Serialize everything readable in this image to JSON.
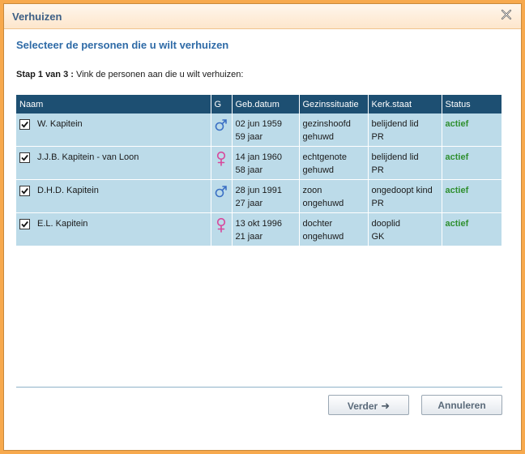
{
  "dialog": {
    "title": "Verhuizen",
    "heading": "Selecteer de personen die u wilt verhuizen",
    "step_bold": "Stap 1 van 3 :",
    "step_text": " Vink de personen aan die u wilt verhuizen:"
  },
  "table": {
    "headers": [
      "Naam",
      "G",
      "Geb.datum",
      "Gezinssituatie",
      "Kerk.staat",
      "Status"
    ],
    "rows": [
      {
        "checked": true,
        "naam": "W. Kapitein",
        "gender": "male-icon",
        "datum": "02 jun 1959",
        "leeftijd": "59 jaar",
        "gezin1": "gezinshoofd",
        "gezin2": "gehuwd",
        "kerk1": "belijdend lid",
        "kerk2": "PR",
        "status": "actief"
      },
      {
        "checked": true,
        "naam": "J.J.B. Kapitein - van Loon",
        "gender": "female-icon",
        "datum": "14 jan 1960",
        "leeftijd": "58 jaar",
        "gezin1": "echtgenote",
        "gezin2": "gehuwd",
        "kerk1": "belijdend lid",
        "kerk2": "PR",
        "status": "actief"
      },
      {
        "checked": true,
        "naam": "D.H.D. Kapitein",
        "gender": "male-icon",
        "datum": "28 jun 1991",
        "leeftijd": "27 jaar",
        "gezin1": "zoon",
        "gezin2": "ongehuwd",
        "kerk1": "ongedoopt kind",
        "kerk2": "PR",
        "status": "actief"
      },
      {
        "checked": true,
        "naam": "E.L. Kapitein",
        "gender": "female-icon",
        "datum": "13 okt 1996",
        "leeftijd": "21 jaar",
        "gezin1": "dochter",
        "gezin2": "ongehuwd",
        "kerk1": "dooplid",
        "kerk2": "GK",
        "status": "actief"
      }
    ]
  },
  "buttons": {
    "next_label": "Verder",
    "next_icon": "arrow-right-icon",
    "cancel_label": "Annuleren"
  },
  "colors": {
    "header_bg": "#1d4f72",
    "row_bg": "#bcdbe9",
    "status_active": "#2f8f2f",
    "male": "#3a6fc4",
    "female": "#d8479b",
    "frame": "#f7a94d"
  }
}
